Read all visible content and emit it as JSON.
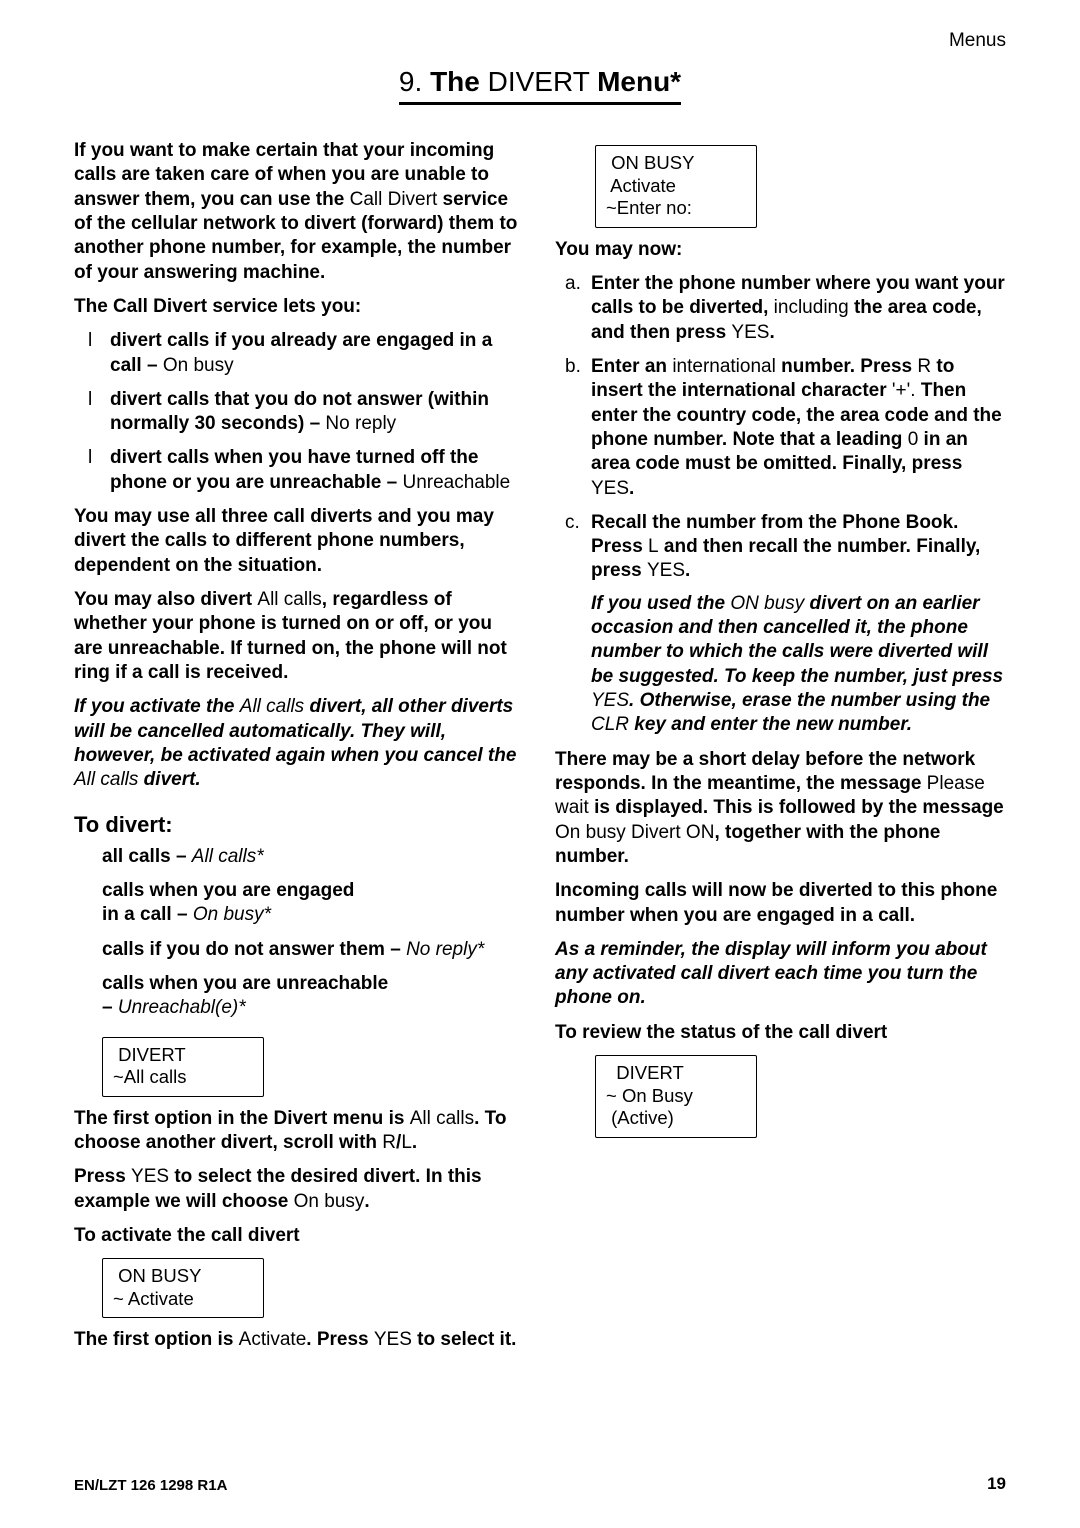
{
  "header": {
    "section": "Menus"
  },
  "title": {
    "prefix": "9. ",
    "b1": "The",
    "mid": " DIVERT ",
    "b2": "Menu*"
  },
  "left": {
    "p1_a": "If you want to make certain that your incoming calls are taken care of when you are unable to answer them, you can use the ",
    "p1_b": "Call Divert",
    "p1_c": " service of the cellular network to divert (forward) them to another phone number, for example, the number of your answering machine.",
    "p2": "The Call Divert service lets you:",
    "bul1_a": "divert calls if you already are engaged in a call – ",
    "bul1_b": "On busy",
    "bul2_a": "divert calls that you do not answer (within normally 30 seconds) – ",
    "bul2_b": "No reply",
    "bul3_a": "divert calls when you have turned off the phone or you are unreachable – ",
    "bul3_b": "Unreach­able",
    "p3": "You may use all three call diverts and you may divert the calls to different phone numbers, dependent on the situation.",
    "p4_a": "You may also divert ",
    "p4_b": "All calls",
    "p4_c": ", regardless of whether your phone is turned on or off, or you are unreachable. If turned on, the phone will not ring if a call is received.",
    "p5_a": "If you activate the ",
    "p5_b": "All calls",
    "p5_c": " divert, all other diverts will be cancelled automatically. They will, however, be activated again when you cancel the ",
    "p5_d": "All calls",
    "p5_e": " divert.",
    "h2": "To divert:",
    "d1_a": "all calls – ",
    "d1_b": "All calls*",
    "d2_a": "calls when you are engaged",
    "d2_b": "in a call – ",
    "d2_c": "On busy*",
    "d3_a": "calls if you do not answer them – ",
    "d3_b": "No reply*",
    "d4_a": "calls when you are unreachable",
    "d4_b": "– ",
    "d4_c": "Unreachabl(e)*",
    "lcd1_l1": " DIVERT",
    "lcd1_l2": "~All calls",
    "p6_a": "The first option in the Divert menu is ",
    "p6_b": "All calls",
    "p6_c": ". To choose another divert, scroll with ",
    "p6_d": "R",
    "p6_e": "/",
    "p6_f": "L",
    "p6_g": ".",
    "p7_a": "Press ",
    "p7_b": "YES",
    "p7_c": " to select the desired divert. In this example we will choose ",
    "p7_d": "On busy",
    "p7_e": "."
  },
  "right": {
    "h1": "To activate the call divert",
    "lcd2_l1": " ON BUSY",
    "lcd2_l2": "~ Activate",
    "p1_a": "The first option is ",
    "p1_b": "Activate",
    "p1_c": ". Press ",
    "p1_d": "YES",
    "p1_e": " to select it.",
    "lcd3_l1": " ON BUSY",
    "lcd3_l2": " Activate",
    "lcd3_l3": "~Enter no:",
    "h2": "You may now:",
    "a_a": "Enter the phone number where you want your calls to be diverted, ",
    "a_b": "including",
    "a_c": " the area code, and then press ",
    "a_d": "YES",
    "a_e": ".",
    "b_a": "Enter an ",
    "b_b": "international",
    "b_c": " number. Press ",
    "b_d": "R",
    "b_e": " to insert the international character ",
    "b_f": "'+'.",
    "b_g": " Then enter the country code, the area code and the phone number. Note that a leading ",
    "b_h": "0",
    "b_i": " in an area code must be omitted. Finally, press ",
    "b_j": "YES",
    "b_k": ".",
    "c_a": "Recall the number from the Phone Book. Press ",
    "c_b": "L",
    "c_c": " and then recall the number. Finally, press ",
    "c_d": "YES",
    "c_e": ".",
    "note_a": "If you used the ",
    "note_b": "ON busy",
    "note_c": " divert on an earlier occasion and then cancelled it, the phone number to which the calls were diverted will be suggested. To keep the number, just press ",
    "note_d": "YES",
    "note_e": ". Otherwise, erase the number using the ",
    "note_f": "CLR",
    "note_g": " key and enter the new number.",
    "p2_a": "There may be a short delay before the network responds. In the meantime, the message ",
    "p2_b": "Please wait",
    "p2_c": " is displayed. This is followed by the message ",
    "p2_d": "On busy Divert ON",
    "p2_e": ", together with the phone number.",
    "p3": "Incoming calls will now be diverted to this phone number when you are engaged in a call.",
    "p4": "As a reminder, the display will inform you about any activated call divert each time you turn the phone on.",
    "h3": "To review the status of the call divert",
    "lcd4_l1": "  DIVERT",
    "lcd4_l2": "~ On Busy",
    "lcd4_l3": " (Active)"
  },
  "footer": {
    "left": "EN/LZT 126 1298  R1A",
    "right": "19"
  }
}
